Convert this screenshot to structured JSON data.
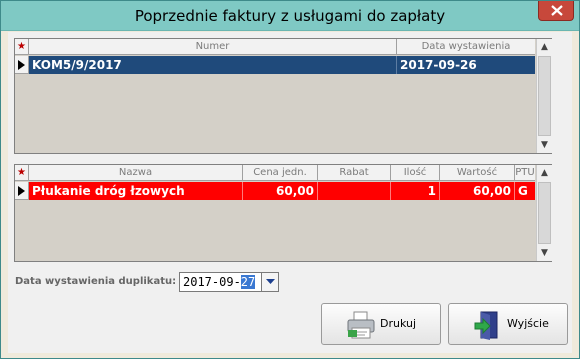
{
  "window": {
    "title": "Poprzednie faktury z usługami do zapłaty"
  },
  "invoices": {
    "columns": [
      "Numer",
      "Data wystawienia"
    ],
    "rows": [
      {
        "numer": "KOM5/9/2017",
        "data": "2017-09-26"
      }
    ]
  },
  "services": {
    "columns": [
      "Nazwa",
      "Cena jedn.",
      "Rabat",
      "Ilość",
      "Wartość",
      "PTU"
    ],
    "rows": [
      {
        "nazwa": "Płukanie dróg łzowych",
        "cena": "60,00",
        "rabat": "",
        "ilosc": "1",
        "wartosc": "60,00",
        "ptu": "G"
      }
    ]
  },
  "duplicate": {
    "label": "Data wystawienia duplikatu:",
    "value_prefix": "2017-09-",
    "value_selected": "27"
  },
  "buttons": {
    "print": "Drukuj",
    "exit": "Wyjście"
  },
  "colors": {
    "selected_row": "#1f4a7b",
    "service_row": "#ff0000",
    "titlebar": "#7fc9c4"
  }
}
